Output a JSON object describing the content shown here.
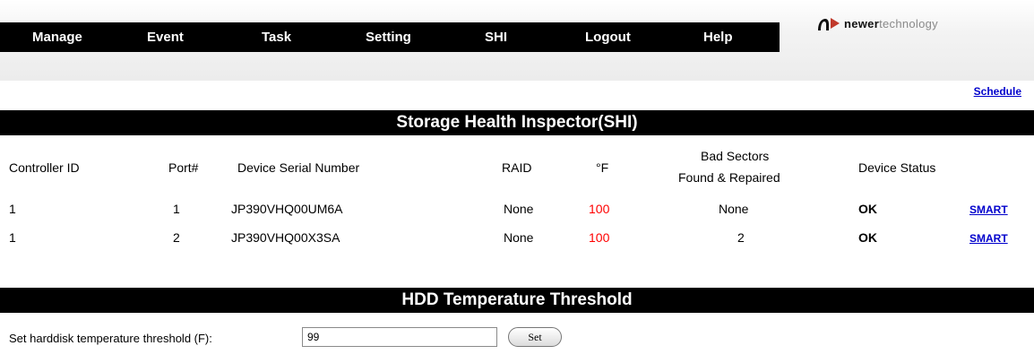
{
  "nav": {
    "items": [
      {
        "label": "Manage"
      },
      {
        "label": "Event"
      },
      {
        "label": "Task"
      },
      {
        "label": "Setting"
      },
      {
        "label": "SHI"
      },
      {
        "label": "Logout"
      },
      {
        "label": "Help"
      }
    ]
  },
  "logo": {
    "bold_text": "newer",
    "light_text": "technology",
    "colors": {
      "mark": "#c0392b",
      "text": "#111111",
      "light": "#8a8a8a"
    }
  },
  "schedule_link": "Schedule",
  "shi": {
    "title": "Storage Health Inspector(SHI)",
    "headers": {
      "controller_id": "Controller ID",
      "port": "Port#",
      "serial": "Device Serial Number",
      "raid": "RAID",
      "temp_unit": "°F",
      "bad_sectors_line1": "Bad Sectors",
      "bad_sectors_line2": "Found & Repaired",
      "device_status": "Device Status"
    },
    "rows": [
      {
        "controller_id": "1",
        "port": "1",
        "serial": "JP390VHQ00UM6A",
        "raid": "None",
        "temp": "100",
        "bad_sectors": "None",
        "status": "OK",
        "smart": "SMART"
      },
      {
        "controller_id": "1",
        "port": "2",
        "serial": "JP390VHQ00X3SA",
        "raid": "None",
        "temp": "100",
        "bad_sectors": "2",
        "status": "OK",
        "smart": "SMART"
      }
    ]
  },
  "threshold": {
    "title": "HDD Temperature Threshold",
    "label": "Set harddisk temperature threshold (F):",
    "value": "99",
    "button": "Set"
  },
  "colors": {
    "navbar_bg": "#000000",
    "link": "#0000cc",
    "temp": "#ff0000"
  }
}
